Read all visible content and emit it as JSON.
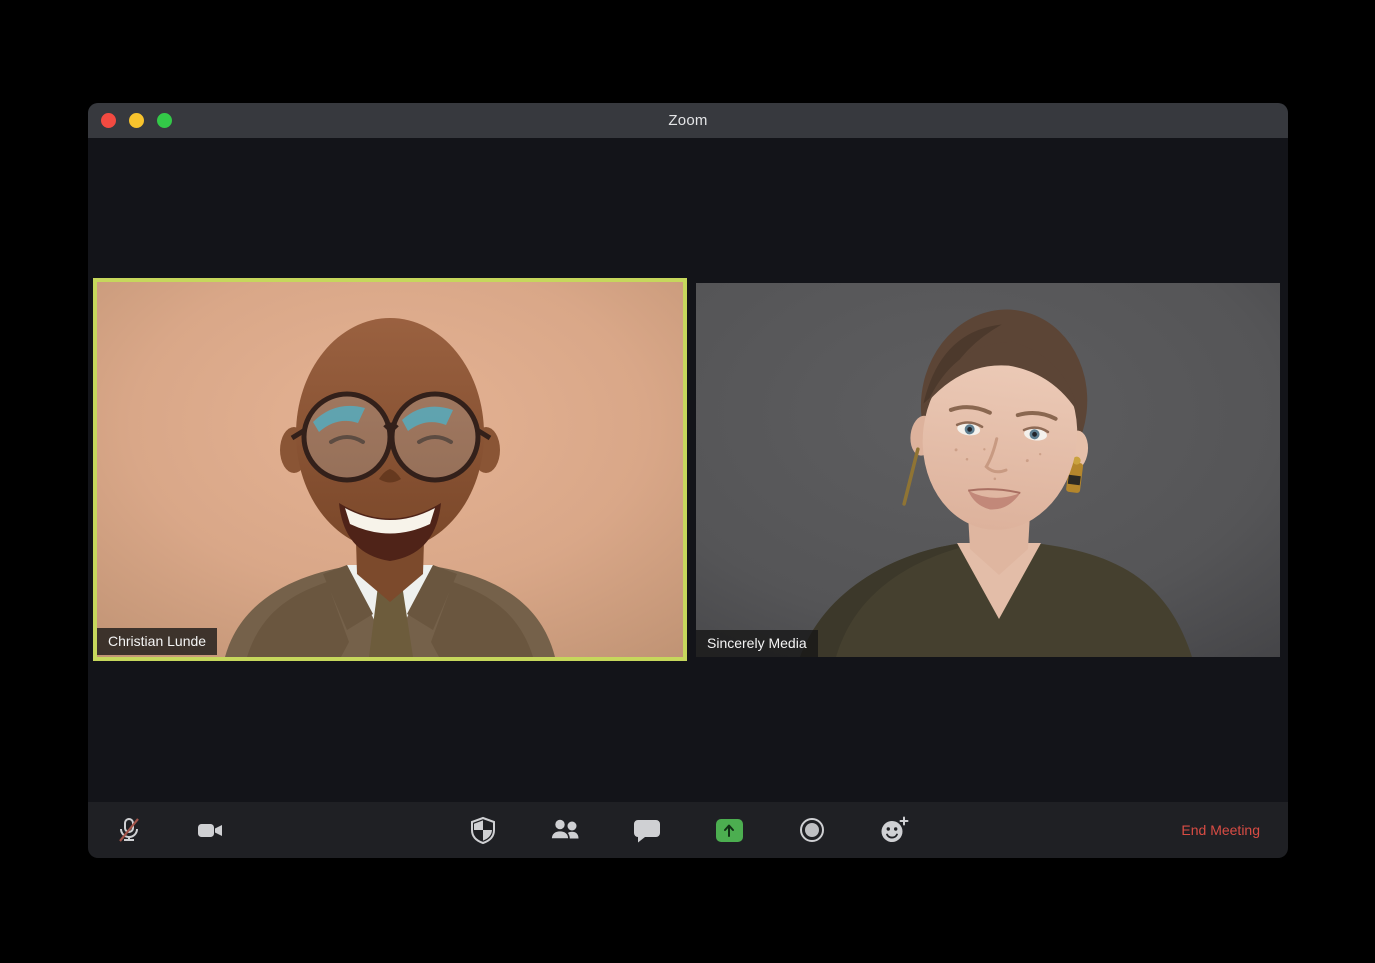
{
  "window": {
    "title": "Zoom",
    "traffic_lights": [
      "close",
      "minimize",
      "fullscreen"
    ]
  },
  "participants": [
    {
      "name": "Christian Lunde",
      "active_speaker": true
    },
    {
      "name": "Sincerely Media",
      "active_speaker": false
    }
  ],
  "toolbar": {
    "buttons": [
      {
        "id": "mute",
        "icon": "microphone-muted-icon",
        "state": "muted"
      },
      {
        "id": "video",
        "icon": "video-camera-icon",
        "state": "on"
      },
      {
        "id": "security",
        "icon": "shield-icon"
      },
      {
        "id": "participants",
        "icon": "participants-icon"
      },
      {
        "id": "chat",
        "icon": "chat-bubble-icon"
      },
      {
        "id": "share-screen",
        "icon": "share-screen-up-arrow-icon",
        "accent": "#4cae50"
      },
      {
        "id": "record",
        "icon": "record-circle-icon"
      },
      {
        "id": "reactions",
        "icon": "smiley-plus-icon"
      }
    ],
    "end_meeting_label": "End Meeting"
  },
  "colors": {
    "active_speaker_border": "#c6d75c",
    "share_button_green": "#4cae50",
    "end_meeting_red": "#d84c44",
    "titlebar": "#37393e",
    "window_body": "#131419",
    "toolbar": "#1f2024"
  }
}
